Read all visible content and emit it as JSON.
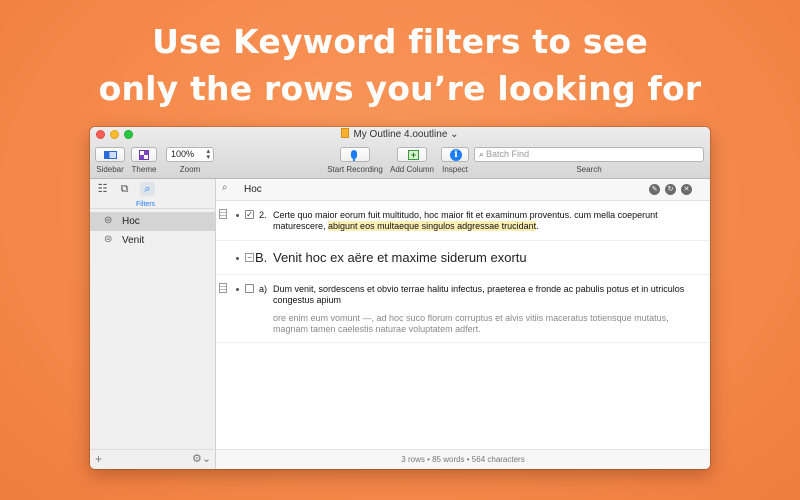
{
  "headline": {
    "line1": "Use Keyword filters to see",
    "line2": "only the rows you’re looking for"
  },
  "window": {
    "title": "My Outline 4.ooutline",
    "title_chevron": "⌄"
  },
  "toolbar": {
    "sidebar_label": "Sidebar",
    "theme_label": "Theme",
    "zoom_value": "100%",
    "zoom_label": "Zoom",
    "start_recording_label": "Start Recording",
    "add_column_label": "Add Column",
    "inspect_label": "Inspect",
    "search_placeholder": "Batch Find",
    "search_label": "Search"
  },
  "sidebar": {
    "filters_label": "Filters",
    "items": [
      {
        "label": "Hoc",
        "selected": true
      },
      {
        "label": "Venit",
        "selected": false
      }
    ],
    "add_symbol": "+",
    "gear_symbol": "⚙⌄"
  },
  "filterbar": {
    "keyword": "Hoc"
  },
  "rows": {
    "row1": {
      "number": "2.",
      "checked": true,
      "line1": "Certe quo maior eorum fuit multitudo, hoc maior fit et examinum proventus. cum mella coeperunt",
      "line2_before": "maturescere, ",
      "line2_highlight": "abigunt eos multaeque singulos adgressae trucidant",
      "line2_after": "."
    },
    "row2": {
      "label": "B.",
      "collapse_symbol": "−",
      "text": "Venit hoc ex aëre et maxime siderum exortu"
    },
    "row3": {
      "number": "a)",
      "checked": false,
      "line1": "Dum venit, sordescens et obvio terrae halitu infectus, praeterea e fronde ac pabulis potus et in utriculos",
      "line2": "congestus apium",
      "note_line1": "ore enim eum vomunt —, ad hoc suco florum corruptus et alvis vitiis maceratus totiensque mutatus,",
      "note_line2": "magnam tamen caelestis naturae voluptatem adfert."
    }
  },
  "status": {
    "text": "3 rows • 85 words • 564 characters"
  },
  "colors": {
    "background": "#f58a4c",
    "accent": "#1f7ef5",
    "highlight": "#fcefb4"
  }
}
